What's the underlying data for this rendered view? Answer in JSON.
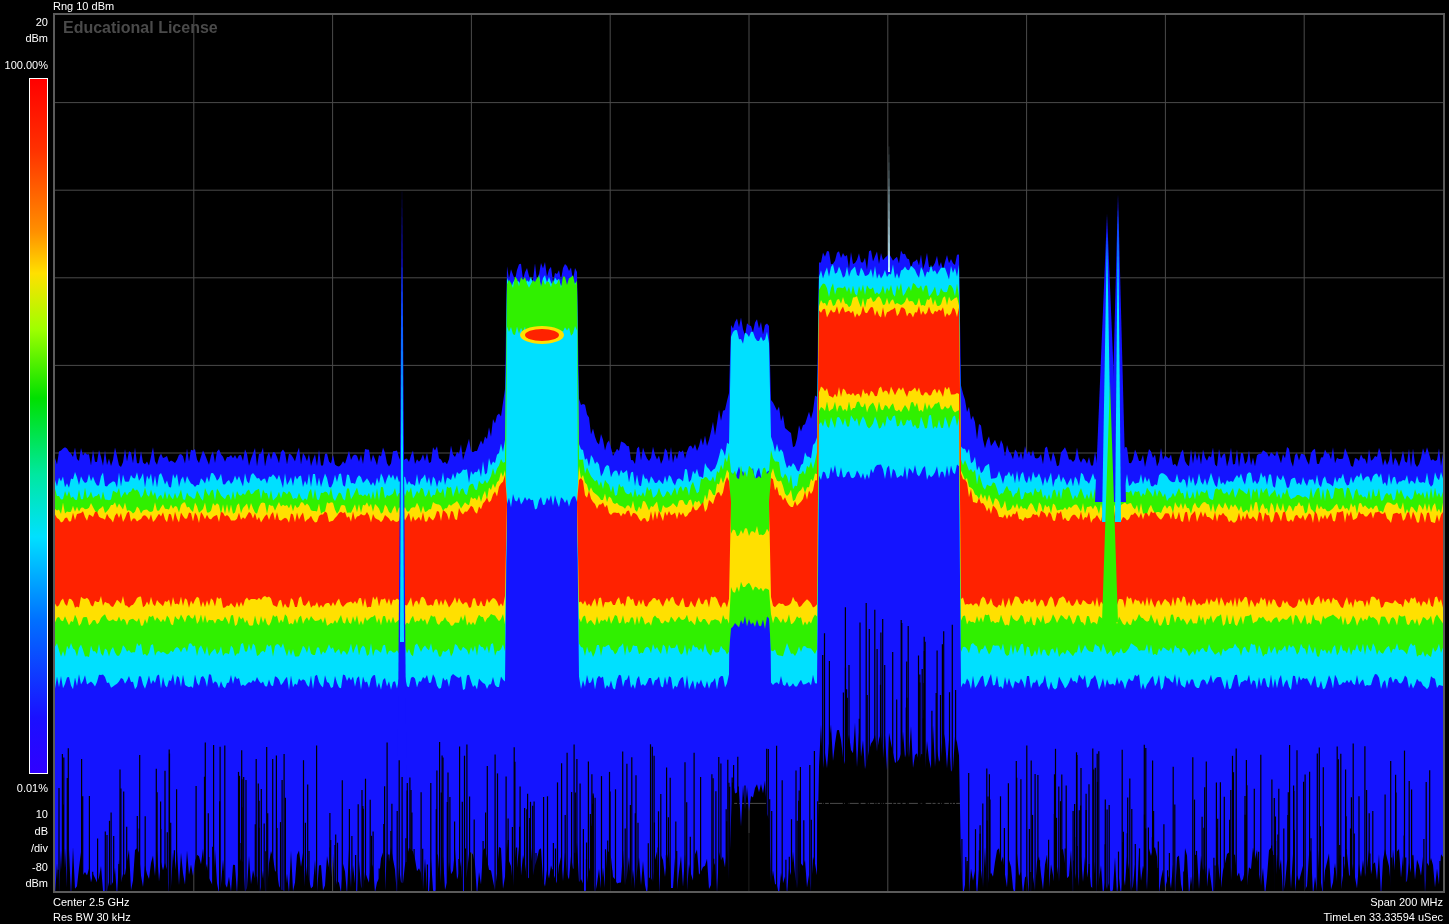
{
  "header": {
    "range": "Rng 10 dBm"
  },
  "plot": {
    "license_notice": "Educational License",
    "kind": "dpx_spectrum"
  },
  "y_axis": {
    "top_value": "20",
    "top_unit": "dBm",
    "scale_value": "10",
    "scale_unit": "dB",
    "scale_per": "/div",
    "bottom_value": "-80",
    "bottom_unit": "dBm"
  },
  "color_scale": {
    "max": "100.00%",
    "min": "0.01%"
  },
  "footer": {
    "left": [
      "Center 2.5 GHz",
      "Res BW 30 kHz"
    ],
    "right": [
      "Span 200 MHz",
      "TimeLen 33.33594 uSec"
    ]
  }
}
